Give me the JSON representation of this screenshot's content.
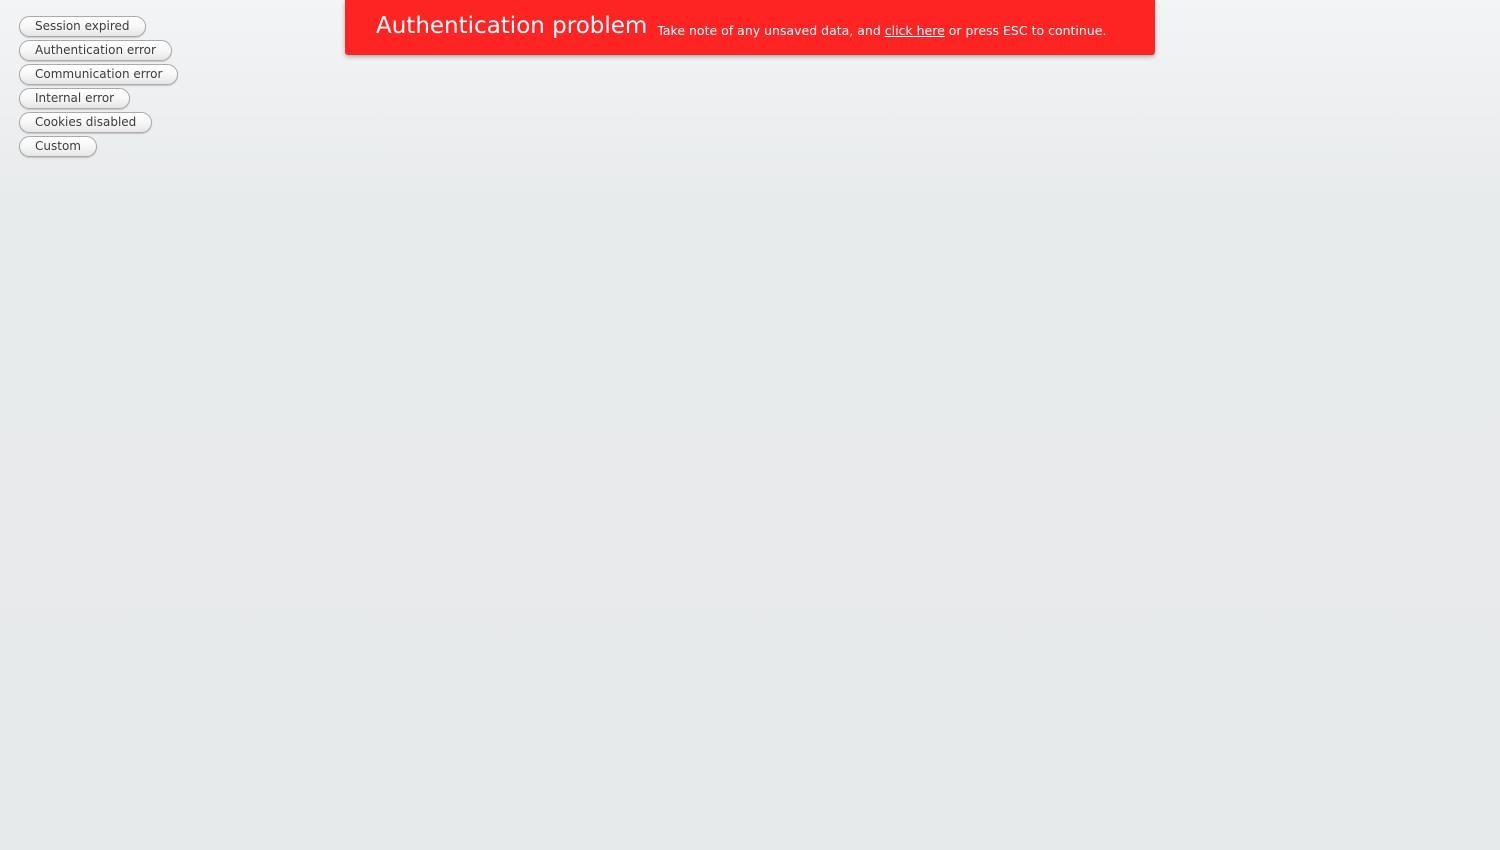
{
  "buttons": [
    {
      "label": "Session expired"
    },
    {
      "label": "Authentication error"
    },
    {
      "label": "Communication error"
    },
    {
      "label": "Internal error"
    },
    {
      "label": "Cookies disabled"
    },
    {
      "label": "Custom"
    }
  ],
  "notification": {
    "caption": "Authentication problem",
    "message_before": "Take note of any unsaved data, and ",
    "link_text": "click here",
    "message_after": " or press ESC to continue.",
    "background_color": "#ff2424",
    "text_color": "#ffffff"
  }
}
